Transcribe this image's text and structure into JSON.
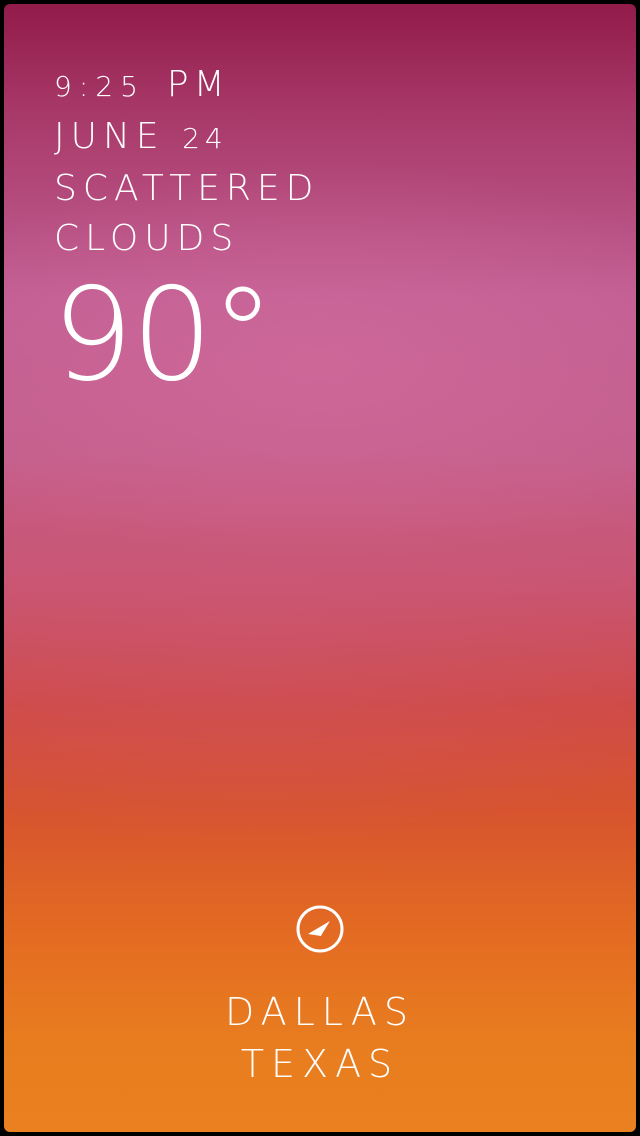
{
  "weather": {
    "time": "9:25",
    "ampm": "PM",
    "date_month": "JUNE",
    "date_day": "24",
    "condition_line1": "SCATTERED",
    "condition_line2": "CLOUDS",
    "temperature": "90°"
  },
  "location": {
    "city": "DALLAS",
    "state": "TEXAS",
    "icon": "location-arrow-icon"
  },
  "colors": {
    "gradient_top": "#921b4a",
    "gradient_mid": "#c25f93",
    "gradient_bottom": "#ea801f",
    "text": "#ffffff"
  }
}
